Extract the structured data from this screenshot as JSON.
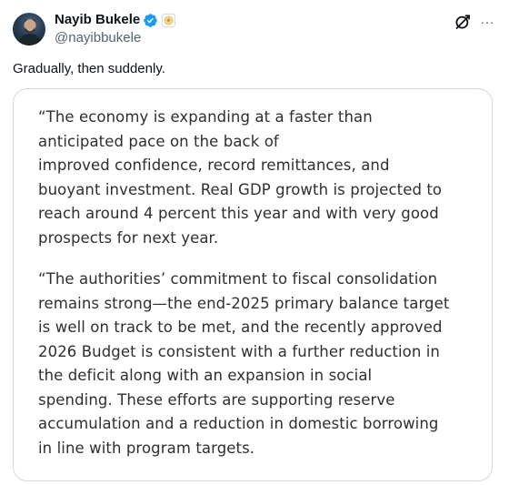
{
  "author": {
    "display_name": "Nayib Bukele",
    "handle": "@nayibbukele",
    "verified": true,
    "avatar_alt": "Profile photo"
  },
  "tweet": {
    "text": "Gradually, then suddenly."
  },
  "media": {
    "paragraphs": [
      {
        "lines": [
          "“The economy is expanding at a faster than",
          "anticipated pace on the back of",
          "improved confidence, record remittances, and",
          "buoyant investment. Real GDP growth is projected to",
          "reach around 4 percent this year and with very good",
          "prospects for next year."
        ]
      },
      {
        "lines": [
          "“The authorities’ commitment to fiscal consolidation",
          "remains strong—the end-2025 primary balance target",
          "is well on track to be met, and the recently approved",
          "2026 Budget is consistent with a further reduction in",
          "the deficit along with an expansion in social",
          "spending. These efforts are supporting reserve",
          "accumulation and a reduction in domestic borrowing",
          "in line with program targets."
        ]
      }
    ]
  },
  "actions": {
    "grok_icon": "grok-icon",
    "more_icon": "more-options-icon",
    "more_glyph": "···"
  },
  "colors": {
    "text_primary": "#0f1419",
    "text_secondary": "#536471",
    "verified_blue": "#1d9bf0",
    "card_border": "#cfd9de",
    "quote_text": "#2f2f2f"
  }
}
